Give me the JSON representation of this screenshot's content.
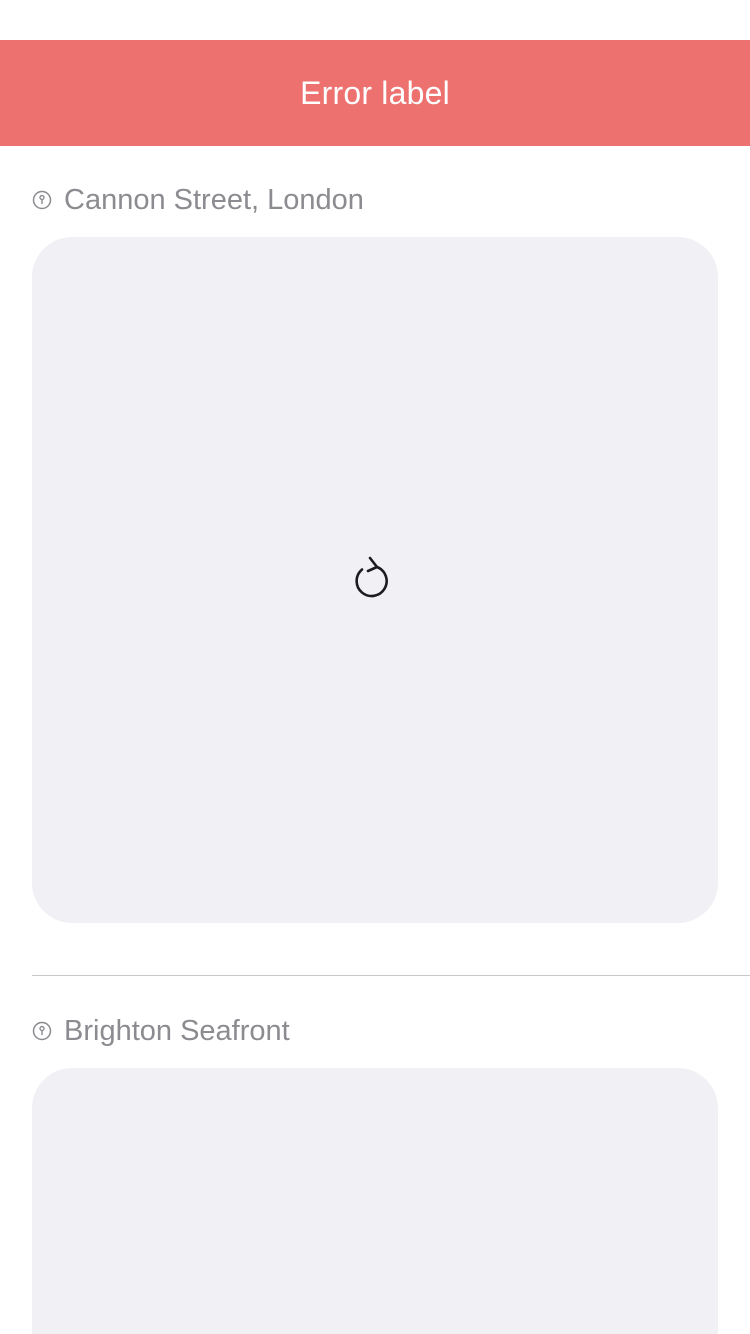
{
  "error_banner": {
    "label": "Error label",
    "color": "#ec716f"
  },
  "locations": [
    {
      "title": "Cannon Street, London",
      "icon": "location-pin-icon",
      "card": {
        "state": "loading",
        "icon": "reload-icon"
      }
    },
    {
      "title": "Brighton Seafront",
      "icon": "location-pin-icon",
      "card": {
        "state": "loading"
      }
    }
  ],
  "colors": {
    "card_background": "#f1f1f5",
    "title_text": "#8b8b90",
    "divider": "#c9c9cd"
  }
}
